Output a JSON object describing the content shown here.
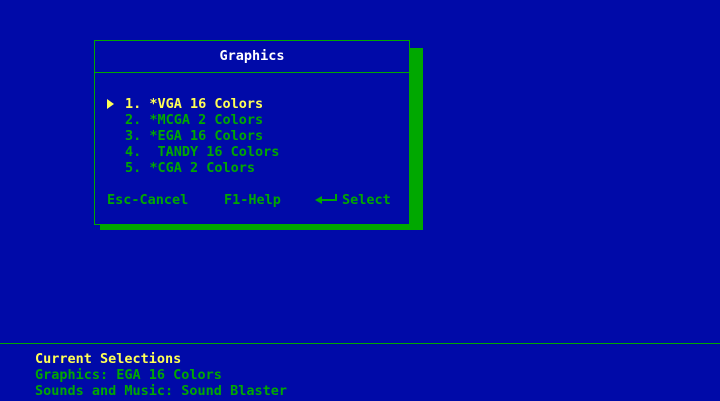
{
  "dialog": {
    "title": "Graphics",
    "options": [
      {
        "text": "1. *VGA 16 Colors",
        "selected": true
      },
      {
        "text": "2. *MCGA 2 Colors",
        "selected": false
      },
      {
        "text": "3. *EGA 16 Colors",
        "selected": false
      },
      {
        "text": "4.  TANDY 16 Colors",
        "selected": false
      },
      {
        "text": "5. *CGA 2 Colors",
        "selected": false
      }
    ],
    "footer": {
      "cancel": "Esc-Cancel",
      "help": "F1-Help",
      "select": "Select",
      "select_icon": "enter-key-icon"
    }
  },
  "status": {
    "heading": "Current Selections",
    "graphics": "Graphics: EGA 16 Colors",
    "sound": "Sounds and Music: Sound Blaster"
  },
  "colors": {
    "background": "#000aa8",
    "border": "#00a800",
    "text": "#00a800",
    "highlight": "#ffff55",
    "title": "#ffffff"
  }
}
